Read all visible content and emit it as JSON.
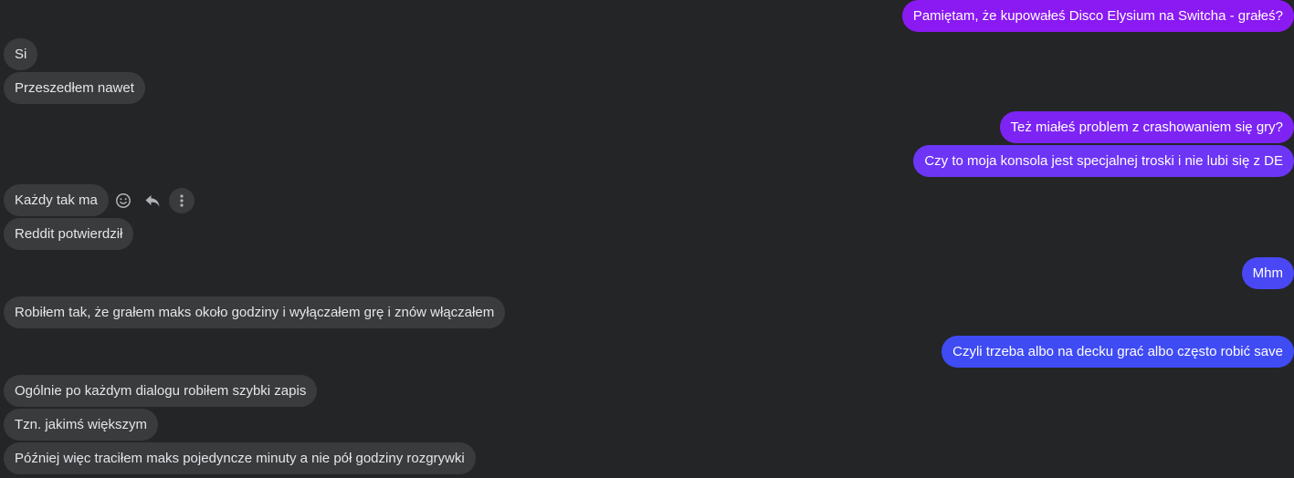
{
  "messages": {
    "m1": "Pamiętam, że kupowałeś Disco Elysium na Switcha - grałeś?",
    "m2": "Si",
    "m3": "Przeszedłem nawet",
    "m4": "Też miałeś problem z crashowaniem się gry?",
    "m5": "Czy to moja konsola jest specjalnej troski i nie lubi się z DE",
    "m6": "Każdy tak ma",
    "m7": "Reddit potwierdził",
    "m8": "Mhm",
    "m9": "Robiłem tak, że grałem maks około godziny i wyłączałem grę i znów włączałem",
    "m10": "Czyli trzeba albo na decku grać albo często robić save",
    "m11": "Ogólnie po każdym dialogu robiłem szybki zapis",
    "m12": "Tzn. jakimś większym",
    "m13": "Później więc traciłem maks pojedyncze minuty a nie pół godziny rozgrywki"
  },
  "message_actions": {
    "react_icon": "smiley-icon",
    "reply_icon": "reply-arrow-icon",
    "more_icon": "more-vertical-icon"
  },
  "colors": {
    "background": "#242526",
    "incoming_bubble": "#3a3b3c",
    "outgoing_purple": "#8a19f2",
    "outgoing_violet": "#6d35f5",
    "outgoing_blue": "#4a48f4",
    "outgoing_indigo": "#3f4bf3"
  }
}
